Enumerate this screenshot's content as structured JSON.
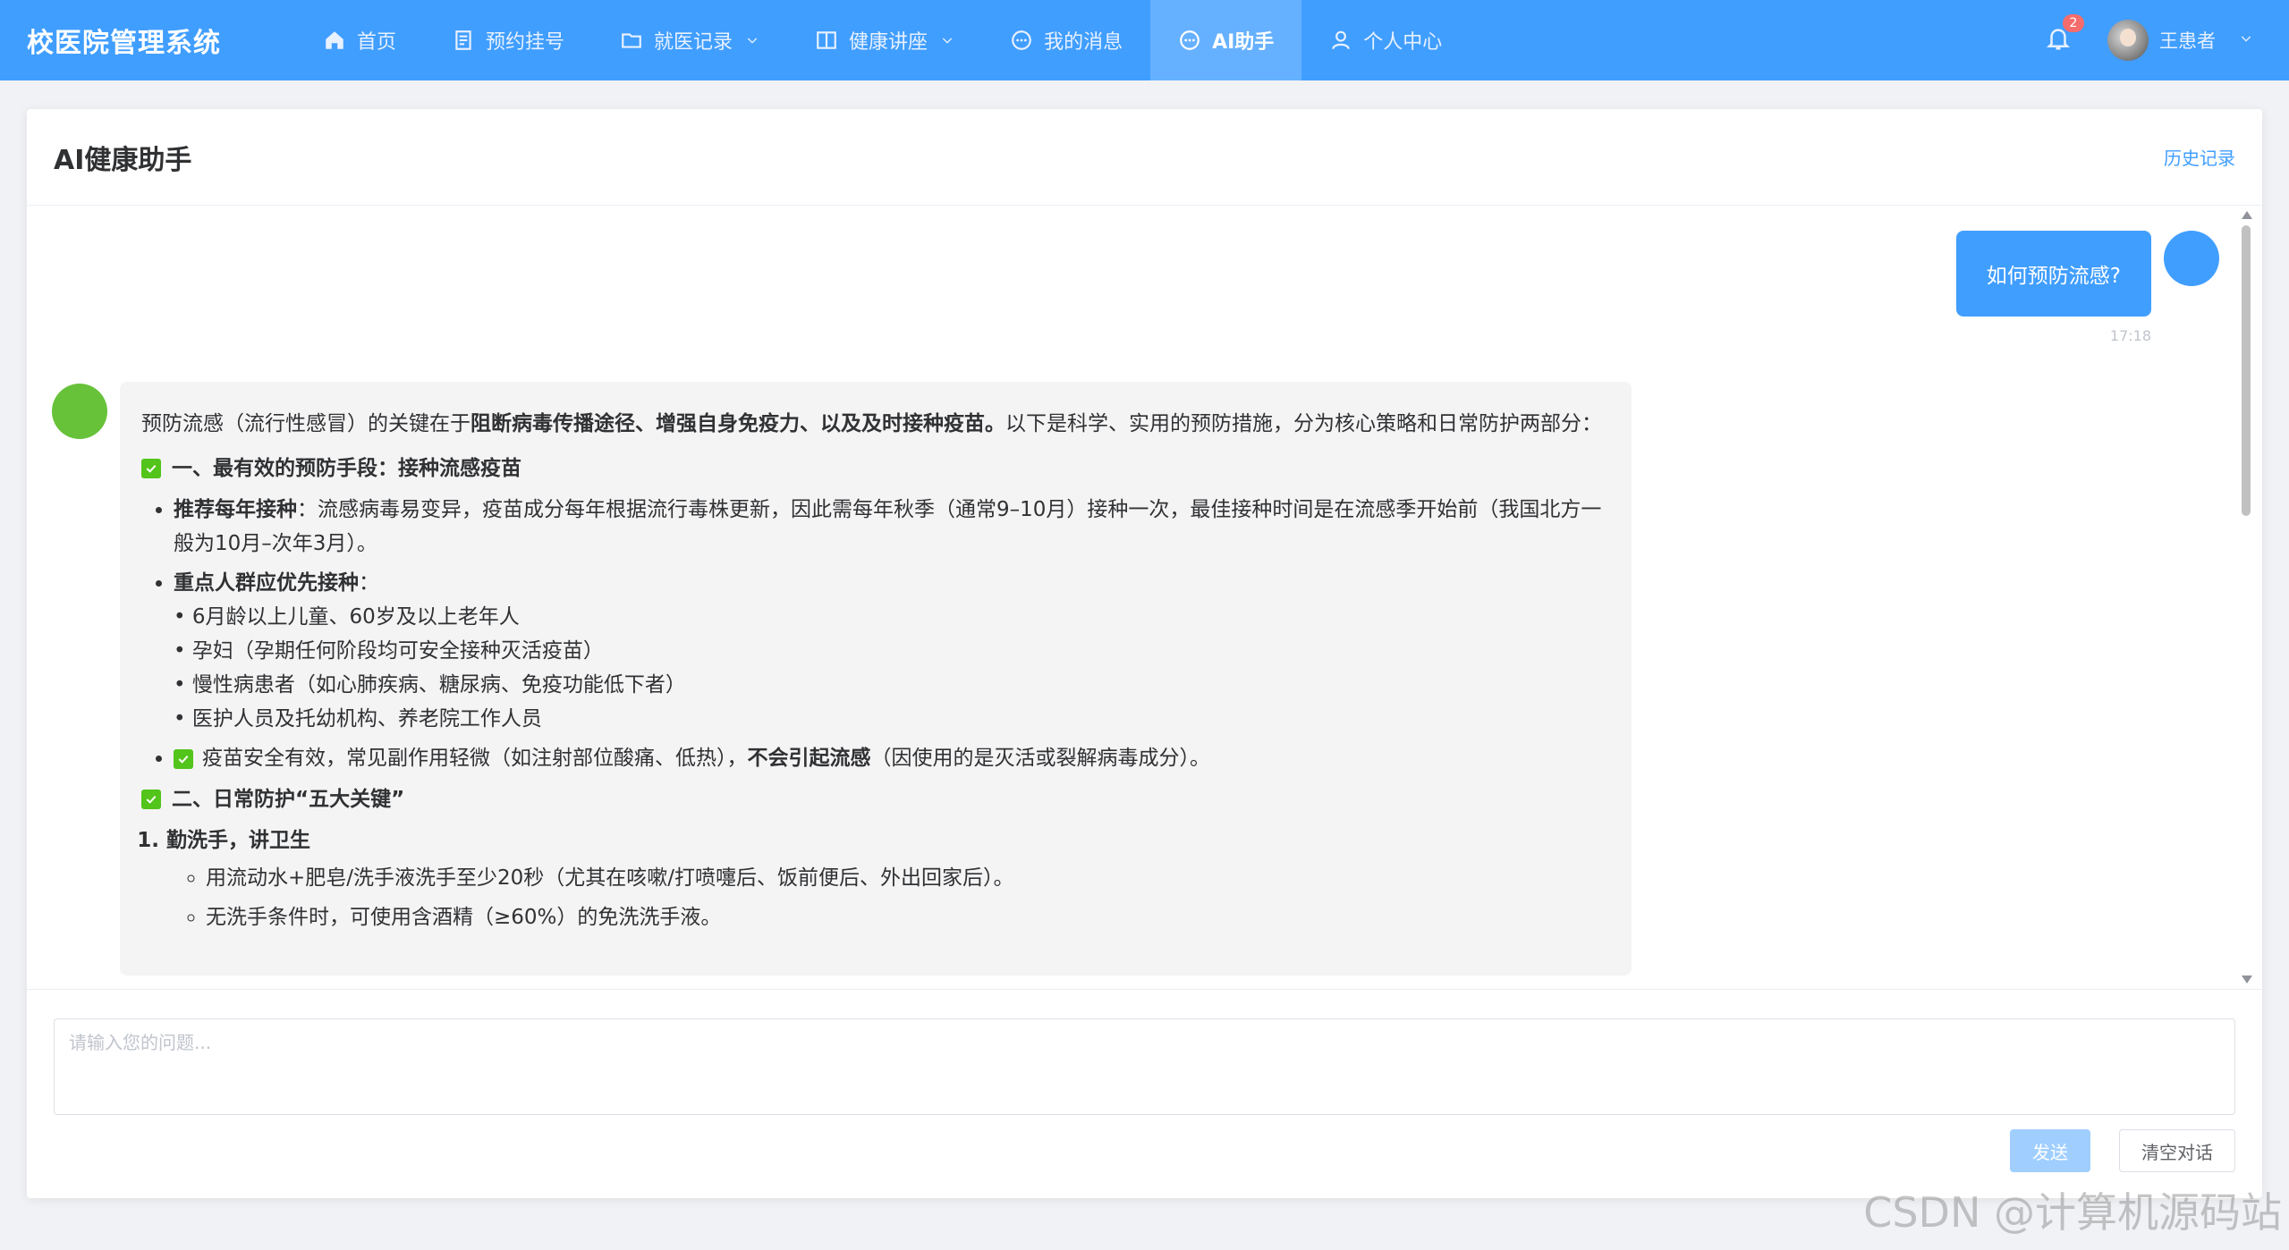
{
  "app": {
    "title": "校医院管理系统"
  },
  "nav": {
    "items": [
      {
        "label": "首页"
      },
      {
        "label": "预约挂号"
      },
      {
        "label": "就医记录"
      },
      {
        "label": "健康讲座"
      },
      {
        "label": "我的消息"
      },
      {
        "label": "AI助手"
      },
      {
        "label": "个人中心"
      }
    ],
    "active": "AI助手"
  },
  "user": {
    "name": "王患者",
    "notification_count": "2"
  },
  "page": {
    "title": "AI健康助手",
    "history_label": "历史记录"
  },
  "chat": {
    "user_message": {
      "text": "如何预防流感?",
      "time": "17:18"
    },
    "ai_message": {
      "intro_pre": "预防流感（流行性感冒）的关键在于",
      "intro_bold": "阻断病毒传播途径、增强自身免疫力、以及及时接种疫苗。",
      "intro_post": "以下是科学、实用的预防措施，分为核心策略和日常防护两部分：",
      "section1_title": "一、最有效的预防手段：接种流感疫苗",
      "s1_b1_bold": "推荐每年接种",
      "s1_b1_text": "：流感病毒易变异，疫苗成分每年根据流行毒株更新，因此需每年秋季（通常9–10月）接种一次，最佳接种时间是在流感季开始前（我国北方一般为10月–次年3月）。",
      "s1_b2_bold": "重点人群应优先接种",
      "s1_b2_colon": "：",
      "s1_b2_sub": [
        "6月龄以上儿童、60岁及以上老年人",
        "孕妇（孕期任何阶段均可安全接种灭活疫苗）",
        "慢性病患者（如心肺疾病、糖尿病、免疫功能低下者）",
        "医护人员及托幼机构、养老院工作人员"
      ],
      "s1_b3_pre": "疫苗安全有效，常见副作用轻微（如注射部位酸痛、低热），",
      "s1_b3_bold": "不会引起流感",
      "s1_b3_post": "（因使用的是灭活或裂解病毒成分）。",
      "section2_title": "二、日常防护“五大关键”",
      "s2_item1_title": "勤洗手，讲卫生",
      "s2_item1_points": [
        "用流动水+肥皂/洗手液洗手至少20秒（尤其在咳嗽/打喷嚏后、饭前便后、外出回家后）。",
        "无洗手条件时，可使用含酒精（≥60%）的免洗洗手液。"
      ]
    }
  },
  "input": {
    "placeholder": "请输入您的问题..."
  },
  "buttons": {
    "send": "发送",
    "clear": "清空对话"
  },
  "watermark": "CSDN @计算机源码站",
  "colors": {
    "primary": "#409eff",
    "ai_avatar": "#67c23a",
    "check": "#52c41a"
  }
}
